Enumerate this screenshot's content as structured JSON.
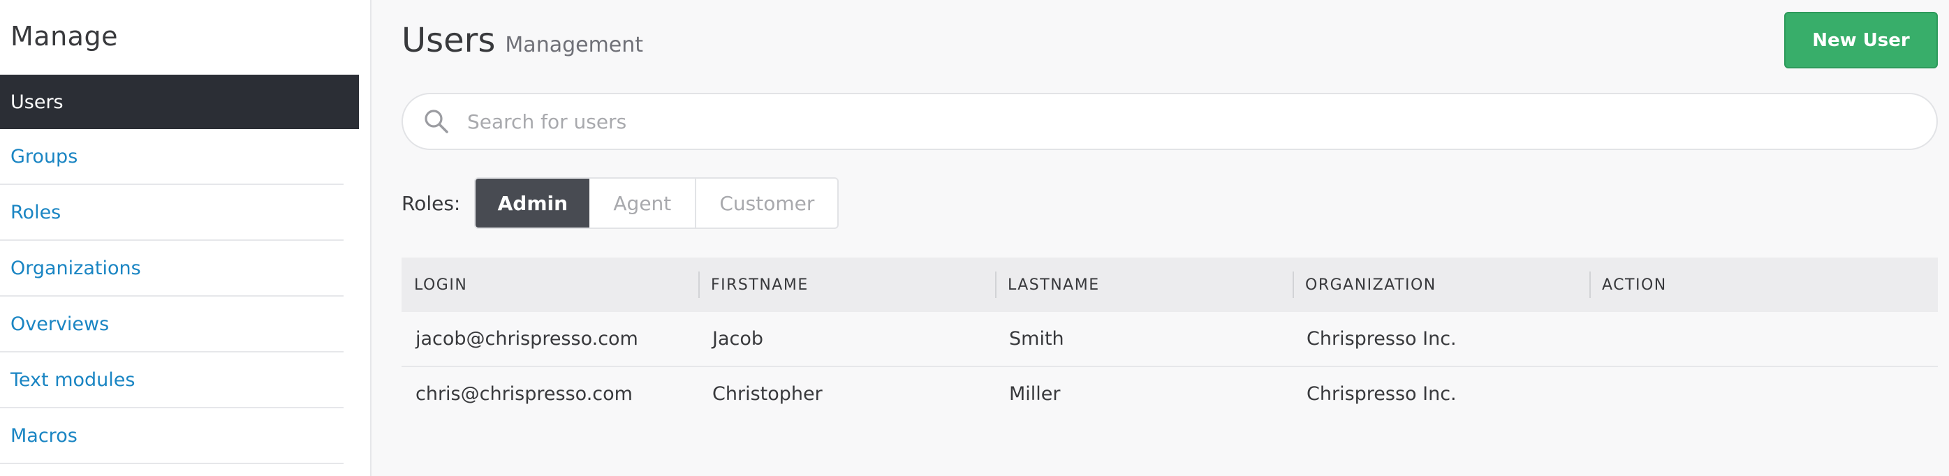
{
  "sidebar": {
    "title": "Manage",
    "items": [
      {
        "label": "Users",
        "active": true
      },
      {
        "label": "Groups"
      },
      {
        "label": "Roles"
      },
      {
        "label": "Organizations"
      },
      {
        "label": "Overviews"
      },
      {
        "label": "Text modules"
      },
      {
        "label": "Macros"
      }
    ]
  },
  "header": {
    "title": "Users",
    "subtitle": "Management",
    "new_user_label": "New User"
  },
  "search": {
    "placeholder": "Search for users",
    "value": ""
  },
  "roles": {
    "label": "Roles:",
    "options": [
      "Admin",
      "Agent",
      "Customer"
    ],
    "selected": "Admin"
  },
  "table": {
    "headers": [
      "LOGIN",
      "FIRSTNAME",
      "LASTNAME",
      "ORGANIZATION",
      "ACTION"
    ],
    "rows": [
      {
        "login": "jacob@chrispresso.com",
        "firstname": "Jacob",
        "lastname": "Smith",
        "organization": "Chrispresso Inc.",
        "action": ""
      },
      {
        "login": "chris@chrispresso.com",
        "firstname": "Christopher",
        "lastname": "Miller",
        "organization": "Chrispresso Inc.",
        "action": ""
      }
    ]
  },
  "colors": {
    "accent_link": "#1a85c3",
    "sidebar_active_bg": "#2b2e35",
    "primary_button": "#38ae6a",
    "role_selected_bg": "#484b52"
  }
}
